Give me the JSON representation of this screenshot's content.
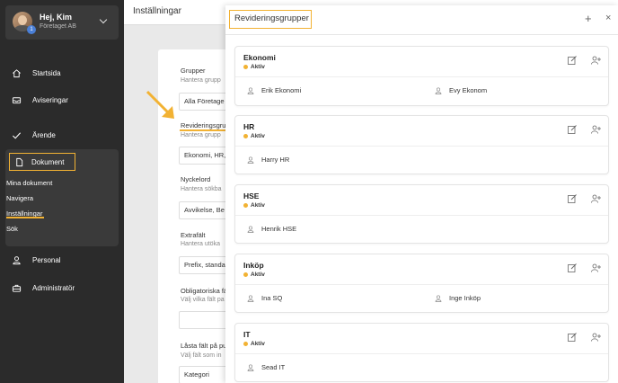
{
  "user": {
    "name": "Hej, Kim",
    "company": "Företaget AB",
    "badge": "1"
  },
  "sidebar": {
    "items": [
      {
        "label": "Startsida",
        "icon": "home-icon"
      },
      {
        "label": "Aviseringar",
        "icon": "inbox-icon"
      },
      {
        "label": "Ärende",
        "icon": "check-icon"
      },
      {
        "label": "Dokument",
        "icon": "document-icon"
      },
      {
        "label": "Personal",
        "icon": "person-icon"
      },
      {
        "label": "Administratör",
        "icon": "toolbox-icon"
      }
    ],
    "document_sub": [
      "Mina dokument",
      "Navigera",
      "Inställningar",
      "Sök"
    ]
  },
  "main": {
    "title": "Inställningar",
    "settings": [
      {
        "label": "Grupper",
        "hint": "Hantera grupp",
        "value": "Alla Företage"
      },
      {
        "label": "Revideringsgrupp",
        "hint": "Hantera grupp",
        "value": "Ekonomi, HR,"
      },
      {
        "label": "Nyckelord",
        "hint": "Hantera sökba",
        "value": "Avvikelse, Be"
      },
      {
        "label": "Extrafält",
        "hint": "Hantera utöka",
        "value": "Prefix, standa"
      },
      {
        "label": "Obligatoriska fä",
        "hint": "Välj vilka fält pa",
        "value": ""
      },
      {
        "label": "Låsta fält på pu",
        "hint": "Välj fält som in",
        "value": "Kategori"
      }
    ]
  },
  "modal": {
    "title": "Revideringsgrupper",
    "plus": "+",
    "close": "×",
    "groups": [
      {
        "name": "Ekonomi",
        "status": "Aktiv",
        "members": [
          "Erik Ekonomi",
          "Evy Ekonom"
        ]
      },
      {
        "name": "HR",
        "status": "Aktiv",
        "members": [
          "Harry HR"
        ]
      },
      {
        "name": "HSE",
        "status": "Aktiv",
        "members": [
          "Henrik HSE"
        ]
      },
      {
        "name": "Inköp",
        "status": "Aktiv",
        "members": [
          "Ina SQ",
          "Inge Inköp"
        ]
      },
      {
        "name": "IT",
        "status": "Aktiv",
        "members": [
          "Sead IT"
        ]
      }
    ]
  },
  "colors": {
    "accent": "#f2b233",
    "sidebar": "#2b2b2b",
    "sidebar_box": "#3a3a3a"
  }
}
